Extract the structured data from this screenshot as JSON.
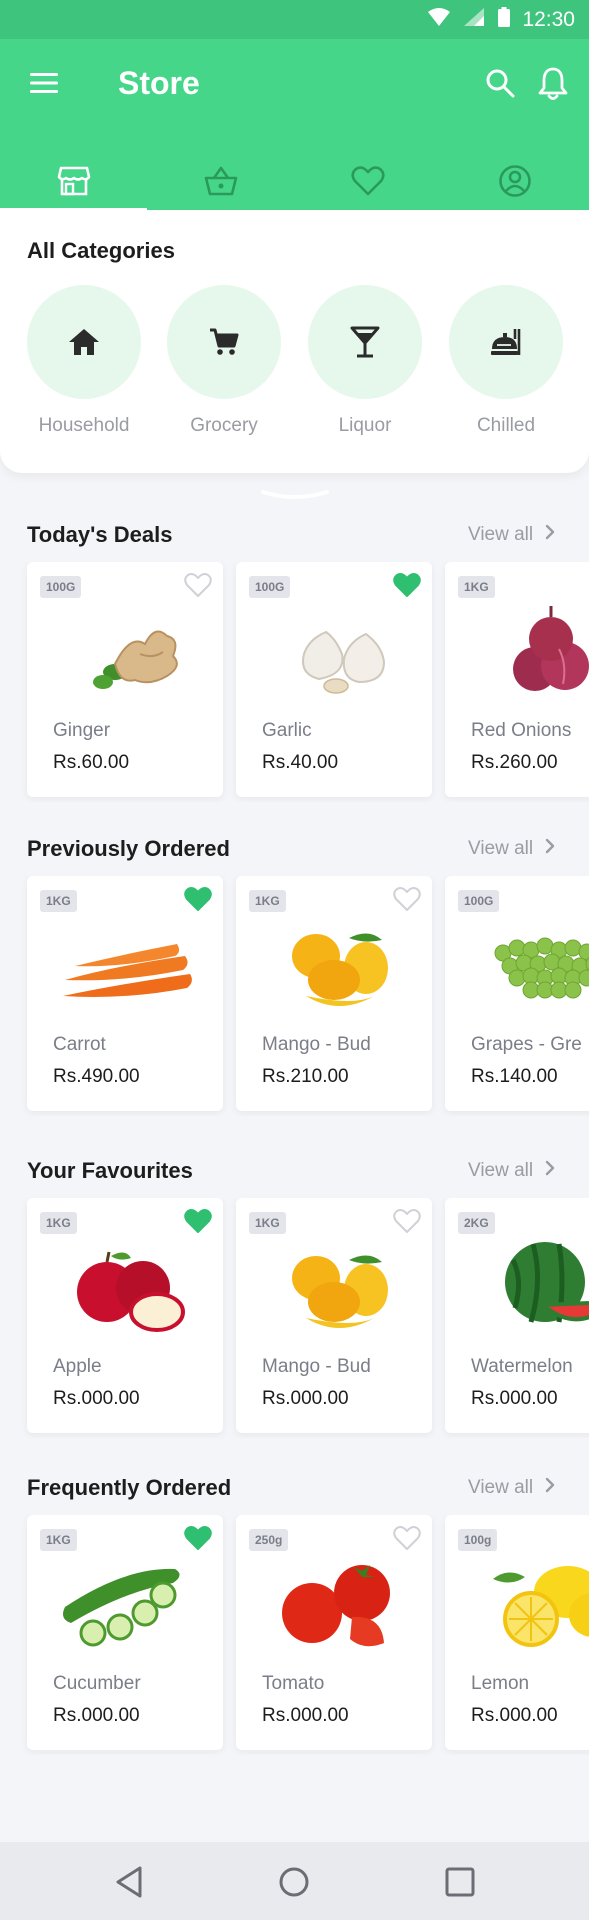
{
  "status_bar": {
    "time": "12:30"
  },
  "app_bar": {
    "title": "Store"
  },
  "categories": {
    "heading": "All Categories",
    "items": [
      {
        "label": "Household",
        "icon": "home-icon"
      },
      {
        "label": "Grocery",
        "icon": "cart-icon"
      },
      {
        "label": "Liquor",
        "icon": "cocktail-icon"
      },
      {
        "label": "Chilled",
        "icon": "chilled-food-icon"
      }
    ]
  },
  "sections": [
    {
      "title": "Today's Deals",
      "view_all": "View all",
      "products": [
        {
          "weight": "100G",
          "name": "Ginger",
          "price": "Rs.60.00",
          "favourite": false
        },
        {
          "weight": "100G",
          "name": "Garlic",
          "price": "Rs.40.00",
          "favourite": true
        },
        {
          "weight": "1KG",
          "name": "Red Onions",
          "price": "Rs.260.00",
          "favourite": false
        }
      ]
    },
    {
      "title": "Previously Ordered",
      "view_all": "View all",
      "products": [
        {
          "weight": "1KG",
          "name": "Carrot",
          "price": "Rs.490.00",
          "favourite": true
        },
        {
          "weight": "1KG",
          "name": "Mango - Bud",
          "price": "Rs.210.00",
          "favourite": false
        },
        {
          "weight": "100G",
          "name": "Grapes - Gre",
          "price": "Rs.140.00",
          "favourite": false
        }
      ]
    },
    {
      "title": "Your Favourites",
      "view_all": "View all",
      "products": [
        {
          "weight": "1KG",
          "name": "Apple",
          "price": "Rs.000.00",
          "favourite": true
        },
        {
          "weight": "1KG",
          "name": "Mango - Bud",
          "price": "Rs.000.00",
          "favourite": false
        },
        {
          "weight": "2KG",
          "name": "Watermelon",
          "price": "Rs.000.00",
          "favourite": false
        }
      ]
    },
    {
      "title": "Frequently Ordered",
      "view_all": "View all",
      "products": [
        {
          "weight": "1KG",
          "name": "Cucumber",
          "price": "Rs.000.00",
          "favourite": true
        },
        {
          "weight": "250g",
          "name": "Tomato",
          "price": "Rs.000.00",
          "favourite": false
        },
        {
          "weight": "100g",
          "name": "Lemon",
          "price": "Rs.000.00",
          "favourite": false
        }
      ]
    }
  ],
  "colors": {
    "brand_green": "#46d68a",
    "status_green": "#3fc47d",
    "category_circle": "#e6f7ec",
    "heart_active": "#2fbf71",
    "heart_inactive": "#cfd1d6"
  }
}
